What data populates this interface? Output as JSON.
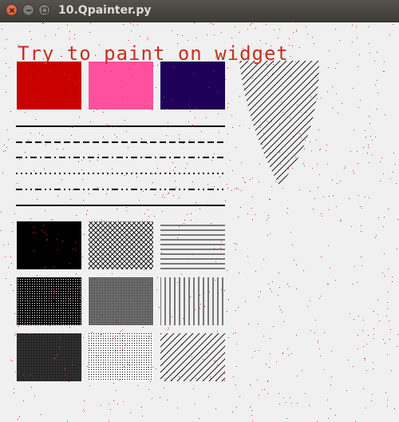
{
  "window": {
    "title": "10.Qpainter.py",
    "buttons": {
      "close": "close",
      "minimize": "minimize",
      "maximize": "maximize"
    }
  },
  "canvas": {
    "heading": "Try to paint on widget",
    "heading_color": "#c4301f",
    "colors": [
      {
        "name": "red",
        "hex": "#c80000"
      },
      {
        "name": "pink",
        "hex": "#ff50a0"
      },
      {
        "name": "navy",
        "hex": "#1e0058"
      }
    ],
    "pen_styles": [
      "solid",
      "dash",
      "dash-dot",
      "dot",
      "dash-dot-dot",
      "solid"
    ],
    "brush_patterns": [
      "solid",
      "diagonal-cross",
      "horizontal",
      "dense-1",
      "dense-2",
      "vertical",
      "dense-3",
      "dense-5",
      "backward-diagonal"
    ]
  }
}
